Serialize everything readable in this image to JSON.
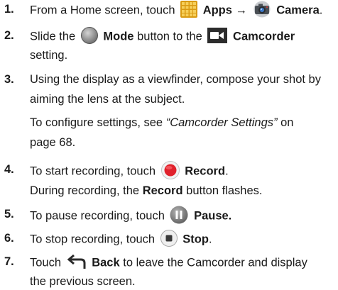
{
  "steps": [
    {
      "number": "1.",
      "prefix": "From a Home screen, touch",
      "apps_label": "Apps",
      "arrow": "→",
      "camera_label": "Camera",
      "end": ".",
      "icons": [
        "apps-grid-icon",
        "camera-icon"
      ]
    },
    {
      "number": "2.",
      "slide": "Slide the",
      "mode_label": "Mode",
      "button_to_the": "button to the",
      "camcorder_label": "Camcorder",
      "line2": "setting.",
      "icons": [
        "mode-button-icon",
        "camcorder-icon"
      ]
    },
    {
      "number": "3.",
      "line1": "Using the display as a viewfinder, compose your shot by",
      "line2": "aiming the lens at the subject.",
      "line3_prefix": "To configure settings, see",
      "line3_ref": "“Camcorder Settings”",
      "line3_suffix": "on",
      "line4": "page 68."
    },
    {
      "number": "4.",
      "prefix": "To start recording, touch",
      "record_label": "Record",
      "end": ".",
      "line2_prefix": "During recording, the",
      "line2_bold": "Record",
      "line2_suffix": "button flashes.",
      "icons": [
        "record-icon"
      ],
      "colors": {
        "record": "#e0212b"
      }
    },
    {
      "number": "5.",
      "prefix": "To pause recording, touch",
      "pause_label": "Pause.",
      "icons": [
        "pause-icon"
      ]
    },
    {
      "number": "6.",
      "prefix": "To stop recording, touch",
      "stop_label": "Stop",
      "end": ".",
      "icons": [
        "stop-icon"
      ]
    },
    {
      "number": "7.",
      "touch": "Touch",
      "back_label": "Back",
      "suffix": "to leave the Camcorder and display",
      "line2": "the previous screen.",
      "icons": [
        "back-arrow-icon"
      ]
    }
  ]
}
